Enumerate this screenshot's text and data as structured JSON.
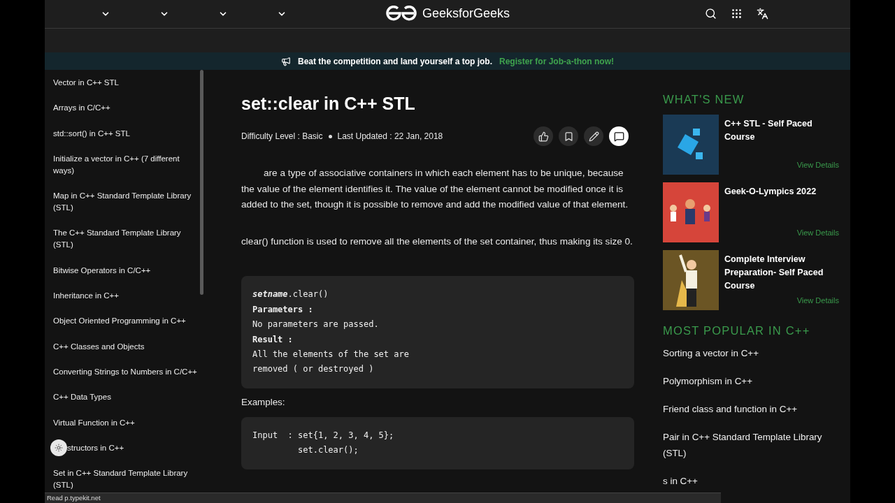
{
  "nav": {
    "dropdowns": [
      {
        "kind": "chevron"
      },
      {
        "kind": "chevron"
      },
      {
        "kind": "chevron"
      },
      {
        "kind": "chevron"
      }
    ],
    "logo": "GeeksforGeeks"
  },
  "banner": {
    "text": "Beat the competition and land yourself a top job.",
    "link": "Register for Job-a-thon now!"
  },
  "sidebar": {
    "items": [
      {
        "label": "Vector in C++ STL",
        "kind": "link"
      },
      {
        "label": "Arrays in C/C++",
        "kind": "link"
      },
      {
        "label": "std::sort() in C++ STL",
        "kind": "link"
      },
      {
        "label": "Initialize a vector in C++ (7 different ways)",
        "kind": "link"
      },
      {
        "label": "Map in C++ Standard Template Library (STL)",
        "kind": "link"
      },
      {
        "label": "The C++ Standard Template Library (STL)",
        "kind": "link"
      },
      {
        "label": "Bitwise Operators in C/C++",
        "kind": "link"
      },
      {
        "label": "Inheritance in C++",
        "kind": "link"
      },
      {
        "label": "Object Oriented Programming in C++",
        "kind": "link"
      },
      {
        "label": "C++ Classes and Objects",
        "kind": "link"
      },
      {
        "label": "Converting Strings to Numbers in C/C++",
        "kind": "link"
      },
      {
        "label": "C++ Data Types",
        "kind": "link"
      },
      {
        "label": "Virtual Function in C++",
        "kind": "link"
      },
      {
        "label": "structors in C++",
        "kind": "with-toggle"
      },
      {
        "label": "Set in C++ Standard Template Library (STL)",
        "kind": "link"
      }
    ]
  },
  "article": {
    "title": "set::clear in C++ STL",
    "difficulty": "Difficulty Level : Basic",
    "updated": "Last Updated : 22 Jan, 2018",
    "paragraphs": [
      "are a type of associative containers in which each element has to be unique, because the value of the element identifies it. The value of the element cannot be modified once it is added to the set, though it is possible to remove and add the modified value of that element.",
      "clear() function is used to remove all the elements of the set container, thus making its size 0."
    ],
    "syntax": [
      {
        "kind": "signature",
        "obj": "setname",
        "call": ".clear()"
      },
      {
        "kind": "heading",
        "text": "Parameters :"
      },
      {
        "kind": "plain",
        "text": "No parameters are passed."
      },
      {
        "kind": "heading",
        "text": "Result :"
      },
      {
        "kind": "plain",
        "text": "All the elements of the set are"
      },
      {
        "kind": "plain",
        "text": "removed ( or destroyed )"
      }
    ],
    "examples_label": "Examples:",
    "examples": [
      "Input  : set{1, 2, 3, 4, 5};",
      "         set.clear();"
    ]
  },
  "whats_new": {
    "title": "WHAT'S NEW",
    "items": [
      {
        "title": "C++ STL - Self Paced Course",
        "kind": "cubes",
        "action": "View Details"
      },
      {
        "title": "Geek-O-Lympics 2022",
        "kind": "characters",
        "action": "View Details"
      },
      {
        "title": "Complete Interview Preparation- Self Paced Course",
        "kind": "hero",
        "action": "View Details"
      }
    ]
  },
  "popular": {
    "title": "MOST POPULAR IN C++",
    "items": [
      "Sorting a vector in C++",
      "Polymorphism in C++",
      "Friend class and function in C++",
      "Pair in C++ Standard Template Library (STL)",
      "s in C++"
    ]
  },
  "status_bar": "Read p.typekit.net"
}
